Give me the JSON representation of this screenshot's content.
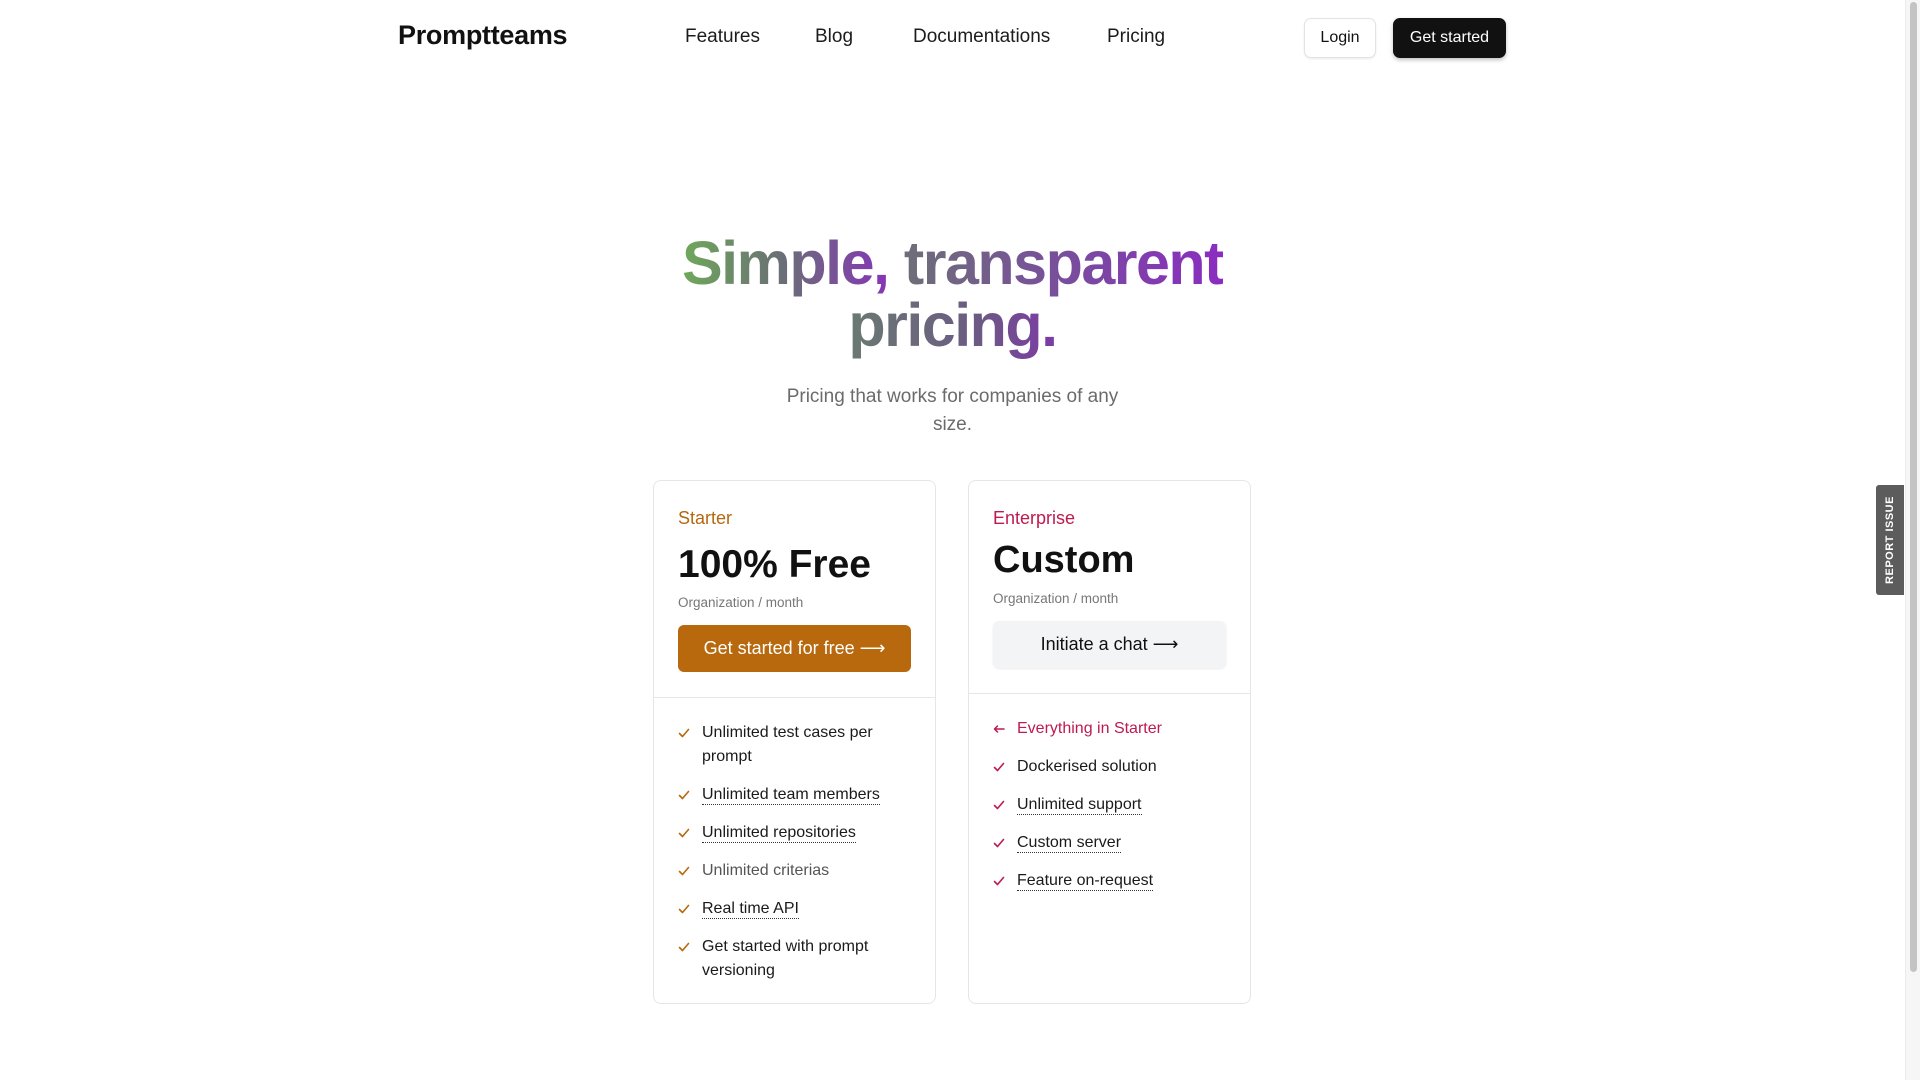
{
  "brand": {
    "name": "Promptteams"
  },
  "nav": {
    "links": [
      "Features",
      "Blog",
      "Documentations",
      "Pricing"
    ],
    "login_label": "Login",
    "get_started_label": "Get started"
  },
  "hero": {
    "title_line1_a": "Simple, ",
    "title_line1_b": "transparent",
    "title_line2": "pricing.",
    "subtitle": "Pricing that works for companies of any size."
  },
  "plans": [
    {
      "tier": "Starter",
      "price": "100% Free",
      "period": "Organization / month",
      "cta": "Get started for free ⟶",
      "features": [
        {
          "text": "Unlimited test cases per prompt",
          "icon": "check-icon"
        },
        {
          "text": "Unlimited team members",
          "icon": "check-icon"
        },
        {
          "text": "Unlimited repositories",
          "icon": "check-icon"
        },
        {
          "text": "Unlimited criterias",
          "icon": "check-icon"
        },
        {
          "text": "Real time API",
          "icon": "check-icon"
        },
        {
          "text": "Get started with prompt versioning",
          "icon": "check-icon"
        }
      ]
    },
    {
      "tier": "Enterprise",
      "price": "Custom",
      "period": "Organization / month",
      "cta": "Initiate a chat ⟶",
      "features": [
        {
          "text": "Everything in Starter",
          "icon": "arrow-left-icon"
        },
        {
          "text": "Dockerised solution",
          "icon": "check-icon"
        },
        {
          "text": "Unlimited support",
          "icon": "check-icon"
        },
        {
          "text": "Custom server",
          "icon": "check-icon"
        },
        {
          "text": "Feature on-request",
          "icon": "check-icon"
        }
      ]
    }
  ],
  "report_tab": {
    "label": "REPORT ISSUE"
  },
  "colors": {
    "starter_accent": "#b8690e",
    "enterprise_accent": "#be1a4f",
    "primary_dark": "#111111"
  }
}
